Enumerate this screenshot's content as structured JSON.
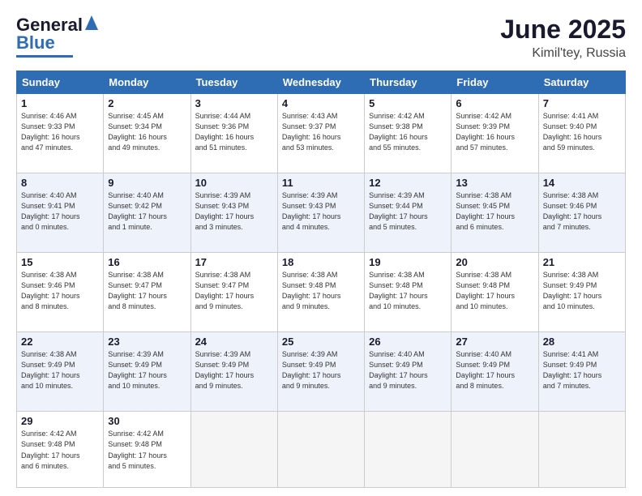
{
  "header": {
    "logo_line1": "General",
    "logo_line2": "Blue",
    "month": "June 2025",
    "location": "Kimil'tey, Russia"
  },
  "weekdays": [
    "Sunday",
    "Monday",
    "Tuesday",
    "Wednesday",
    "Thursday",
    "Friday",
    "Saturday"
  ],
  "weeks": [
    [
      {
        "day": "1",
        "info": "Sunrise: 4:46 AM\nSunset: 9:33 PM\nDaylight: 16 hours\nand 47 minutes."
      },
      {
        "day": "2",
        "info": "Sunrise: 4:45 AM\nSunset: 9:34 PM\nDaylight: 16 hours\nand 49 minutes."
      },
      {
        "day": "3",
        "info": "Sunrise: 4:44 AM\nSunset: 9:36 PM\nDaylight: 16 hours\nand 51 minutes."
      },
      {
        "day": "4",
        "info": "Sunrise: 4:43 AM\nSunset: 9:37 PM\nDaylight: 16 hours\nand 53 minutes."
      },
      {
        "day": "5",
        "info": "Sunrise: 4:42 AM\nSunset: 9:38 PM\nDaylight: 16 hours\nand 55 minutes."
      },
      {
        "day": "6",
        "info": "Sunrise: 4:42 AM\nSunset: 9:39 PM\nDaylight: 16 hours\nand 57 minutes."
      },
      {
        "day": "7",
        "info": "Sunrise: 4:41 AM\nSunset: 9:40 PM\nDaylight: 16 hours\nand 59 minutes."
      }
    ],
    [
      {
        "day": "8",
        "info": "Sunrise: 4:40 AM\nSunset: 9:41 PM\nDaylight: 17 hours\nand 0 minutes."
      },
      {
        "day": "9",
        "info": "Sunrise: 4:40 AM\nSunset: 9:42 PM\nDaylight: 17 hours\nand 1 minute."
      },
      {
        "day": "10",
        "info": "Sunrise: 4:39 AM\nSunset: 9:43 PM\nDaylight: 17 hours\nand 3 minutes."
      },
      {
        "day": "11",
        "info": "Sunrise: 4:39 AM\nSunset: 9:43 PM\nDaylight: 17 hours\nand 4 minutes."
      },
      {
        "day": "12",
        "info": "Sunrise: 4:39 AM\nSunset: 9:44 PM\nDaylight: 17 hours\nand 5 minutes."
      },
      {
        "day": "13",
        "info": "Sunrise: 4:38 AM\nSunset: 9:45 PM\nDaylight: 17 hours\nand 6 minutes."
      },
      {
        "day": "14",
        "info": "Sunrise: 4:38 AM\nSunset: 9:46 PM\nDaylight: 17 hours\nand 7 minutes."
      }
    ],
    [
      {
        "day": "15",
        "info": "Sunrise: 4:38 AM\nSunset: 9:46 PM\nDaylight: 17 hours\nand 8 minutes."
      },
      {
        "day": "16",
        "info": "Sunrise: 4:38 AM\nSunset: 9:47 PM\nDaylight: 17 hours\nand 8 minutes."
      },
      {
        "day": "17",
        "info": "Sunrise: 4:38 AM\nSunset: 9:47 PM\nDaylight: 17 hours\nand 9 minutes."
      },
      {
        "day": "18",
        "info": "Sunrise: 4:38 AM\nSunset: 9:48 PM\nDaylight: 17 hours\nand 9 minutes."
      },
      {
        "day": "19",
        "info": "Sunrise: 4:38 AM\nSunset: 9:48 PM\nDaylight: 17 hours\nand 10 minutes."
      },
      {
        "day": "20",
        "info": "Sunrise: 4:38 AM\nSunset: 9:48 PM\nDaylight: 17 hours\nand 10 minutes."
      },
      {
        "day": "21",
        "info": "Sunrise: 4:38 AM\nSunset: 9:49 PM\nDaylight: 17 hours\nand 10 minutes."
      }
    ],
    [
      {
        "day": "22",
        "info": "Sunrise: 4:38 AM\nSunset: 9:49 PM\nDaylight: 17 hours\nand 10 minutes."
      },
      {
        "day": "23",
        "info": "Sunrise: 4:39 AM\nSunset: 9:49 PM\nDaylight: 17 hours\nand 10 minutes."
      },
      {
        "day": "24",
        "info": "Sunrise: 4:39 AM\nSunset: 9:49 PM\nDaylight: 17 hours\nand 9 minutes."
      },
      {
        "day": "25",
        "info": "Sunrise: 4:39 AM\nSunset: 9:49 PM\nDaylight: 17 hours\nand 9 minutes."
      },
      {
        "day": "26",
        "info": "Sunrise: 4:40 AM\nSunset: 9:49 PM\nDaylight: 17 hours\nand 9 minutes."
      },
      {
        "day": "27",
        "info": "Sunrise: 4:40 AM\nSunset: 9:49 PM\nDaylight: 17 hours\nand 8 minutes."
      },
      {
        "day": "28",
        "info": "Sunrise: 4:41 AM\nSunset: 9:49 PM\nDaylight: 17 hours\nand 7 minutes."
      }
    ],
    [
      {
        "day": "29",
        "info": "Sunrise: 4:42 AM\nSunset: 9:48 PM\nDaylight: 17 hours\nand 6 minutes."
      },
      {
        "day": "30",
        "info": "Sunrise: 4:42 AM\nSunset: 9:48 PM\nDaylight: 17 hours\nand 5 minutes."
      },
      null,
      null,
      null,
      null,
      null
    ]
  ]
}
